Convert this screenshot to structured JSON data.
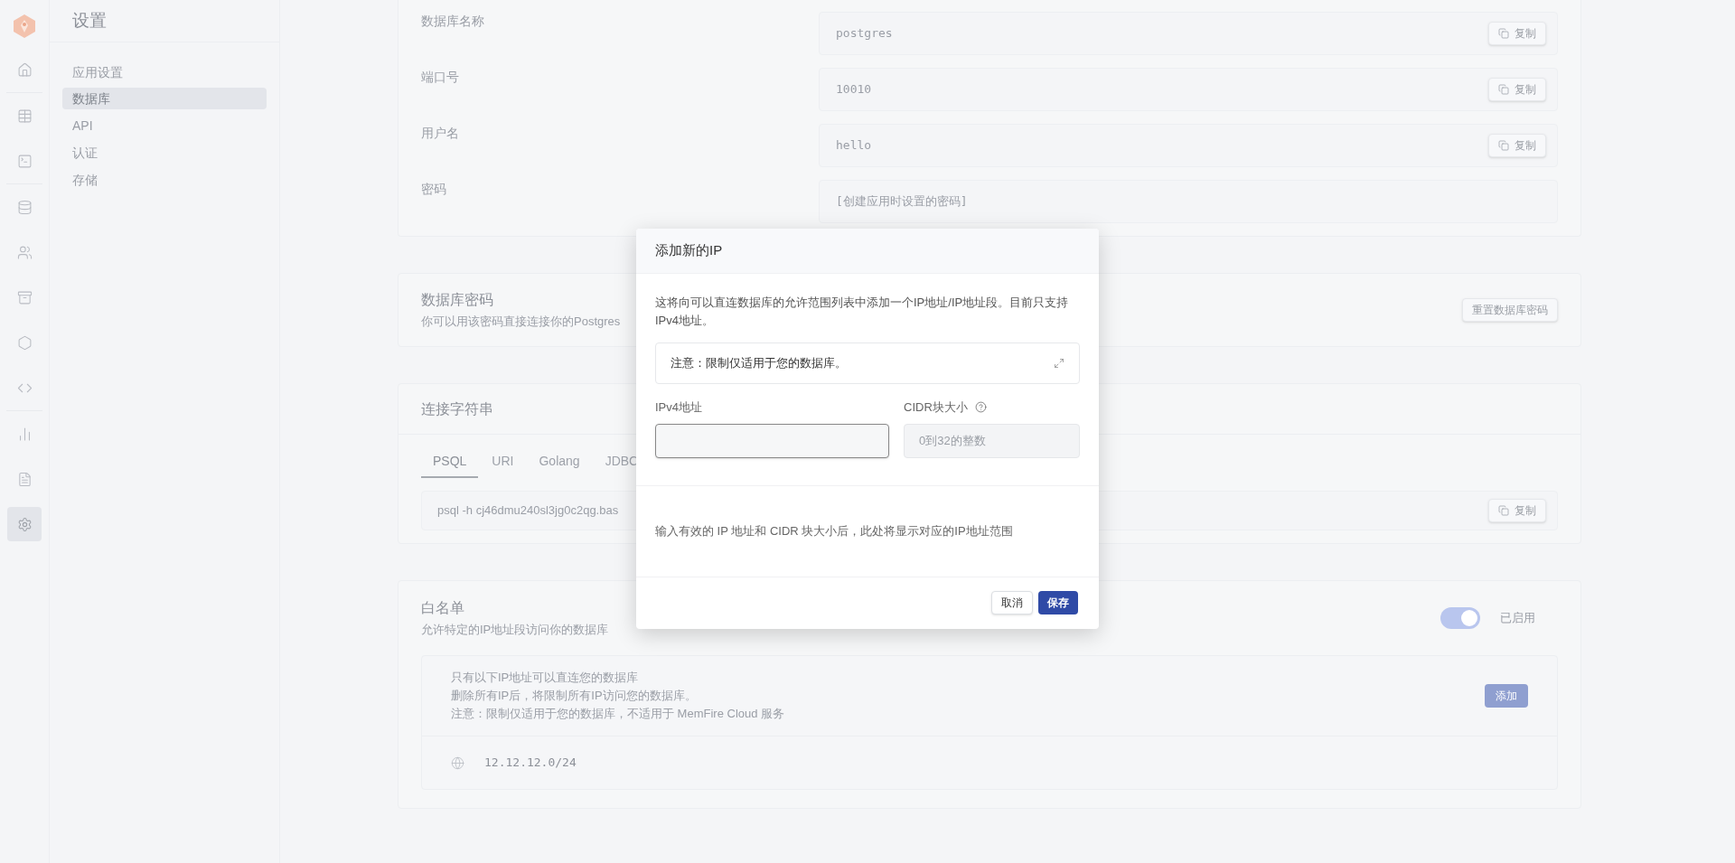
{
  "rail": [
    {
      "selected": false
    },
    {
      "selected": false
    },
    {
      "selected": false
    },
    {
      "selected": false
    },
    {
      "selected": false
    },
    {
      "selected": false
    },
    {
      "selected": false
    },
    {
      "selected": false
    },
    {
      "selected": false
    },
    {
      "selected": false
    },
    {
      "selected": true
    }
  ],
  "settings_nav": {
    "title": "设置",
    "section": "应用设置",
    "items": [
      {
        "label": "数据库",
        "selected": true
      },
      {
        "label": "API",
        "selected": false
      },
      {
        "label": "认证",
        "selected": false
      },
      {
        "label": "存储",
        "selected": false
      }
    ]
  },
  "connection_info": {
    "fields": [
      {
        "label": "数据库名称",
        "value": "postgres",
        "copy": "复制"
      },
      {
        "label": "端口号",
        "value": "10010",
        "copy": "复制"
      },
      {
        "label": "用户名",
        "value": "hello",
        "copy": "复制"
      },
      {
        "label": "密码",
        "value": "[创建应用时设置的密码]"
      }
    ]
  },
  "db_password": {
    "title": "数据库密码",
    "description": "你可以用该密码直接连接你的Postgres",
    "button": "重置数据库密码"
  },
  "connection_string": {
    "title": "连接字符串",
    "tabs": [
      {
        "label": "PSQL",
        "selected": true
      },
      {
        "label": "URI",
        "selected": false
      },
      {
        "label": "Golang",
        "selected": false
      },
      {
        "label": "JDBC",
        "selected": false
      }
    ],
    "value": "psql -h cj46dmu240sl3jg0c2qg.bas",
    "copy": "复制"
  },
  "whitelist": {
    "title": "白名单",
    "description": "允许特定的IP地址段访问你的数据库",
    "enabled": true,
    "status": "已启用",
    "notes": [
      "只有以下IP地址可以直连您的数据库",
      "删除所有IP后，将限制所有IP访问您的数据库。",
      "注意：限制仅适用于您的数据库，不适用于 MemFire Cloud 服务"
    ],
    "add_button": "添加",
    "entries": [
      "12.12.12.0/24"
    ]
  },
  "dialog": {
    "title": "添加新的IP",
    "description": "这将向可以直连数据库的允许范围列表中添加一个IP地址/IP地址段。目前只支持IPv4地址。",
    "notice": "注意：限制仅适用于您的数据库。",
    "ipv4_label": "IPv4地址",
    "cidr_label": "CIDR块大小",
    "cidr_placeholder": "0到32的整数",
    "cidr_disabled": true,
    "hint": "输入有效的 IP 地址和 CIDR 块大小后，此处将显示对应的IP地址范围",
    "cancel": "取消",
    "save": "保存"
  }
}
